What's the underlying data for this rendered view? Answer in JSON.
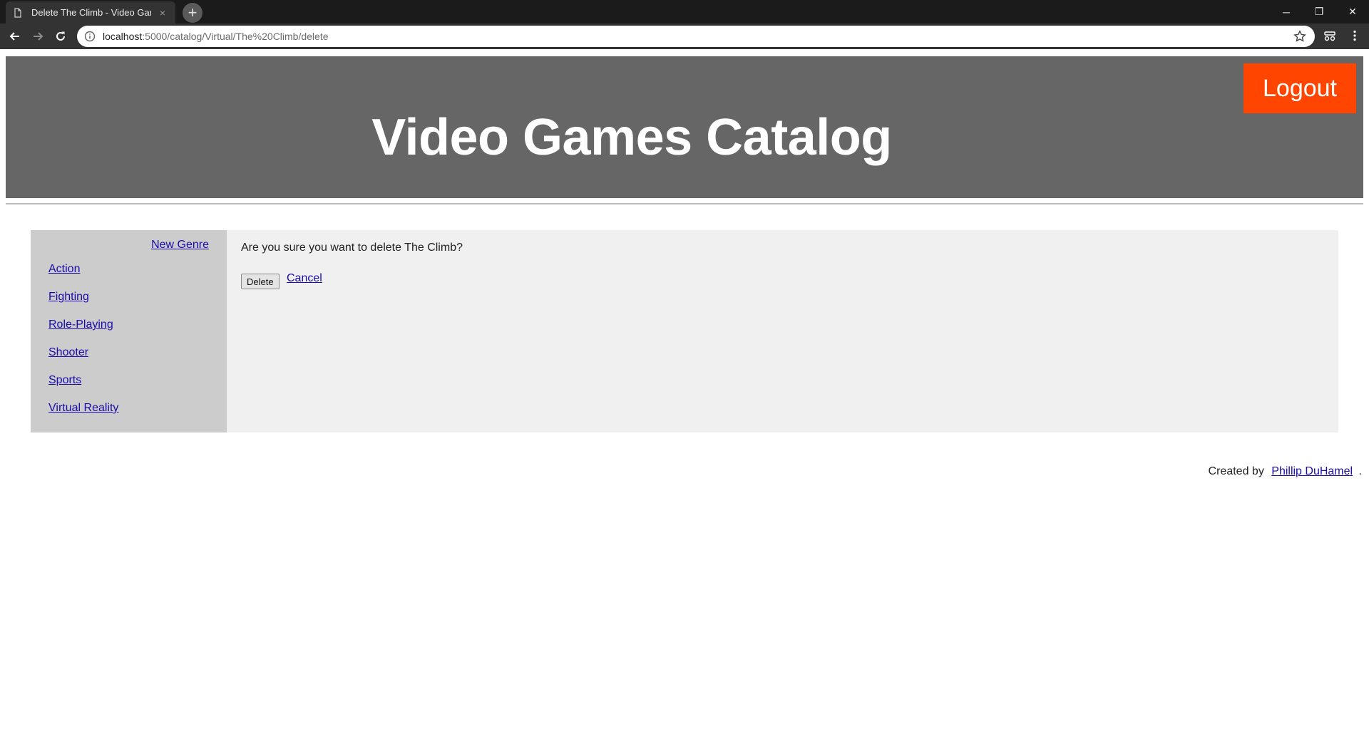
{
  "browser": {
    "tab_title": "Delete The Climb - Video Games",
    "tab_close": "×",
    "new_tab": "+",
    "url_host": "localhost",
    "url_rest": ":5000/catalog/Virtual/The%20Climb/delete",
    "window": {
      "minimize": "─",
      "restore": "❐",
      "close": "✕"
    }
  },
  "header": {
    "title": "Video Games Catalog",
    "logout_label": "Logout"
  },
  "sidebar": {
    "new_genre_label": "New Genre",
    "genres": [
      {
        "label": "Action"
      },
      {
        "label": "Fighting"
      },
      {
        "label": "Role-Playing"
      },
      {
        "label": "Shooter"
      },
      {
        "label": "Sports"
      },
      {
        "label": "Virtual Reality"
      }
    ]
  },
  "confirm": {
    "question": "Are you sure you want to delete The Climb?",
    "delete_label": "Delete",
    "cancel_label": "Cancel"
  },
  "footer": {
    "prefix": "Created by",
    "author": "Phillip DuHamel",
    "suffix": "."
  },
  "colors": {
    "header_bg": "#666666",
    "logout_bg": "#ff4500",
    "sidebar_bg": "#cccccc",
    "content_bg": "#f0f0f0",
    "link": "#1a0dab"
  }
}
